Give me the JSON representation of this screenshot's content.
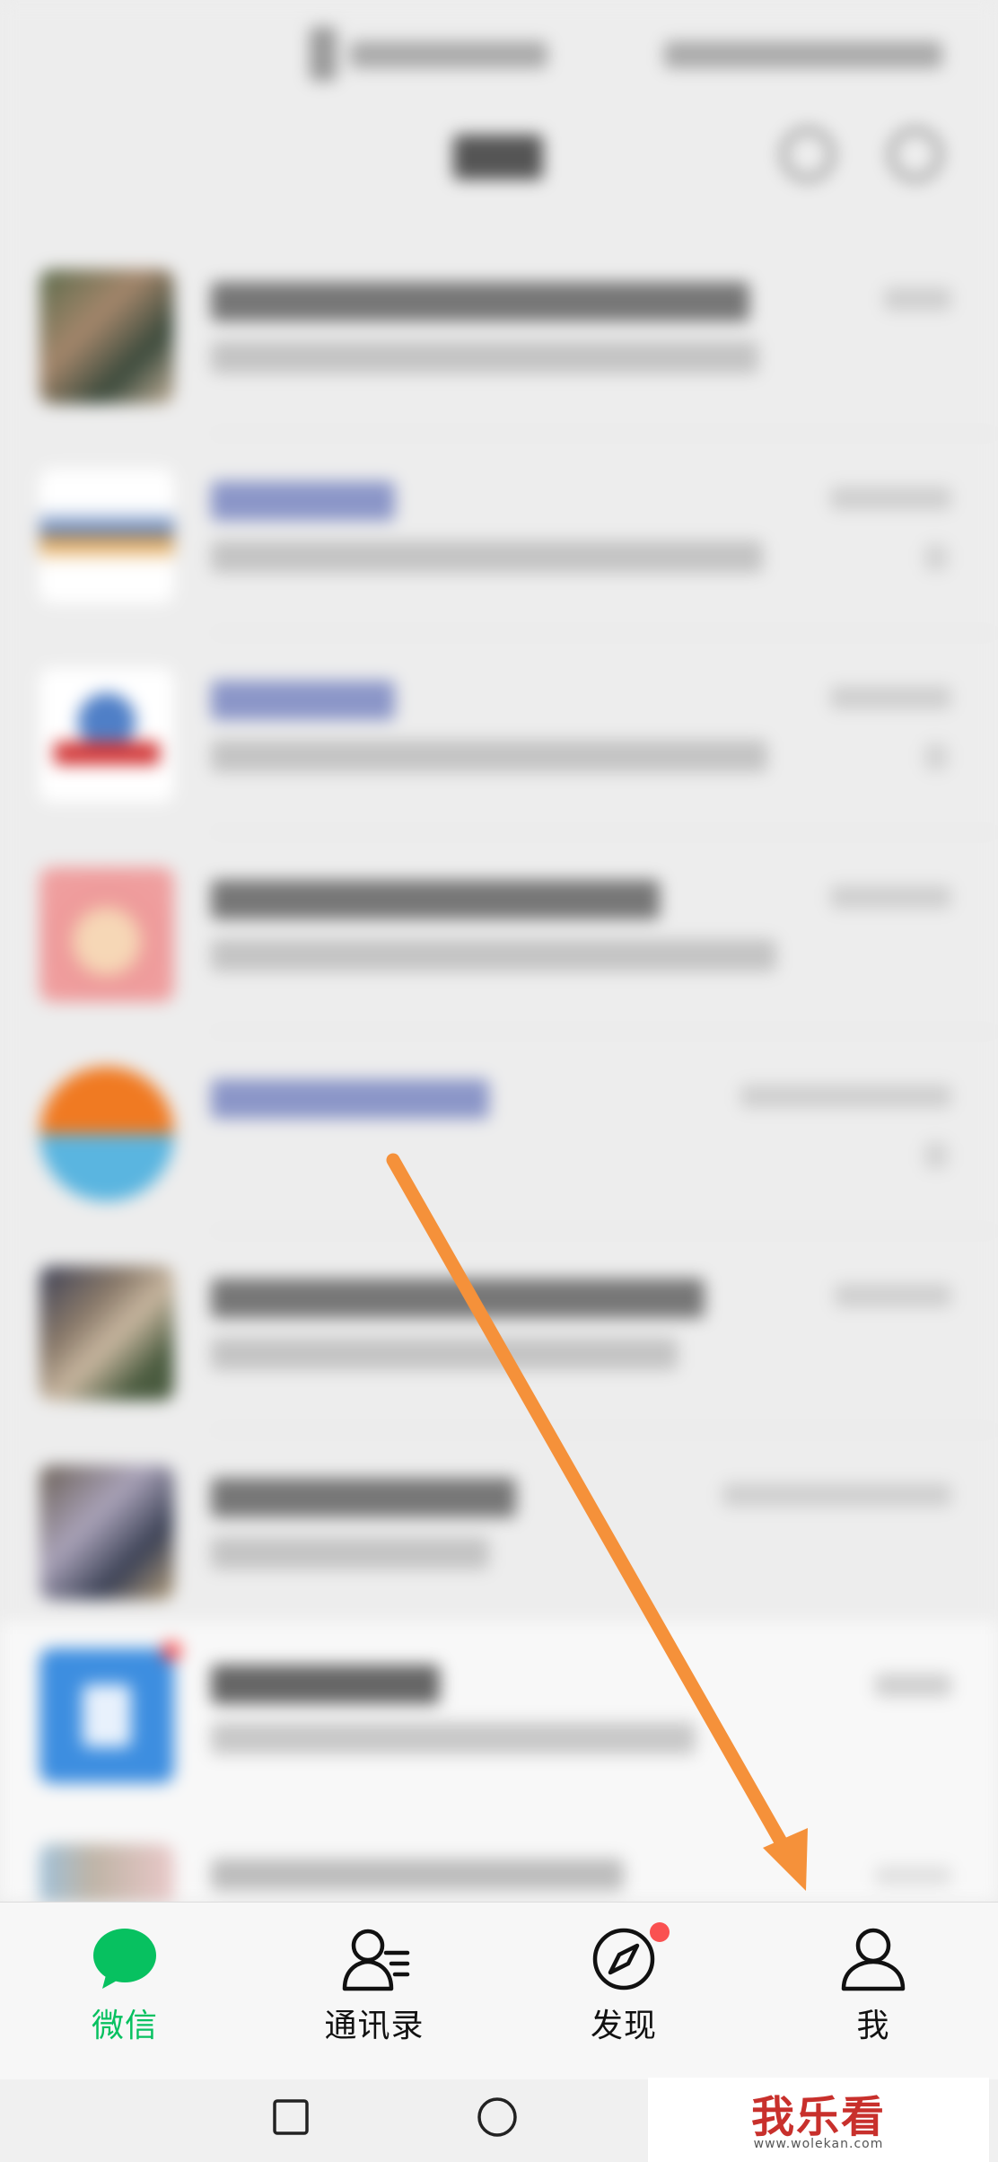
{
  "tabs": [
    {
      "label": "微信",
      "icon": "chat-bubble-icon",
      "active": true
    },
    {
      "label": "通讯录",
      "icon": "contacts-icon",
      "active": false
    },
    {
      "label": "发现",
      "icon": "compass-icon",
      "active": false,
      "badge": "red-dot"
    },
    {
      "label": "我",
      "icon": "person-icon",
      "active": false
    }
  ],
  "chat_list": {
    "visible_time_partial": "10:30"
  },
  "android_nav": {
    "buttons": [
      "recent-apps",
      "home"
    ]
  },
  "watermark": {
    "text": "我乐看",
    "url": "www.wolekan.com"
  },
  "annotation": {
    "arrow_color": "#f5913a",
    "points_to": "我"
  },
  "colors": {
    "accent": "#07c160",
    "badge": "#fa5151",
    "arrow": "#f5913a"
  }
}
